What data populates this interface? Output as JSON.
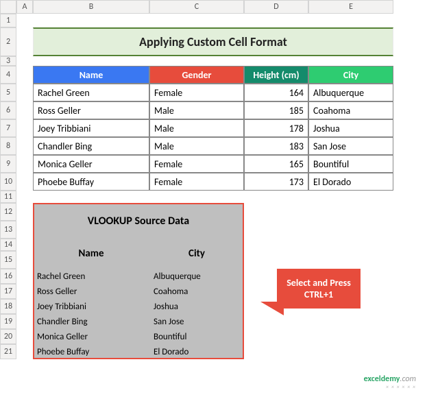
{
  "columns": [
    "A",
    "B",
    "C",
    "D",
    "E"
  ],
  "rows": [
    "1",
    "2",
    "3",
    "4",
    "5",
    "6",
    "7",
    "8",
    "9",
    "10",
    "11",
    "12",
    "13",
    "14",
    "15",
    "16",
    "17",
    "18",
    "19",
    "20",
    "21"
  ],
  "title": "Applying Custom Cell Format",
  "headers": {
    "name": "Name",
    "gender": "Gender",
    "height": "Height (cm)",
    "city": "City"
  },
  "people": [
    {
      "name": "Rachel Green",
      "gender": "Female",
      "height": "164",
      "city": "Albuquerque"
    },
    {
      "name": "Ross Geller",
      "gender": "Male",
      "height": "185",
      "city": "Coahoma"
    },
    {
      "name": "Joey Tribbiani",
      "gender": "Male",
      "height": "178",
      "city": "Joshua"
    },
    {
      "name": "Chandler Bing",
      "gender": "Male",
      "height": "183",
      "city": "San Jose"
    },
    {
      "name": "Monica Geller",
      "gender": "Female",
      "height": "165",
      "city": "Bountiful"
    },
    {
      "name": "Phoebe Buffay",
      "gender": "Female",
      "height": "173",
      "city": "El Dorado"
    }
  ],
  "source": {
    "title": "VLOOKUP Source Data",
    "name_hdr": "Name",
    "city_hdr": "City",
    "rows": [
      {
        "name": "Rachel Green",
        "city": "Albuquerque"
      },
      {
        "name": "Ross Geller",
        "city": "Coahoma"
      },
      {
        "name": "Joey Tribbiani",
        "city": "Joshua"
      },
      {
        "name": "Chandler Bing",
        "city": "San Jose"
      },
      {
        "name": "Monica Geller",
        "city": "Bountiful"
      },
      {
        "name": "Phoebe Buffay",
        "city": "El Dorado"
      }
    ]
  },
  "callout": "Select and Press CTRL+1",
  "watermark": {
    "brand": "exceldemy",
    "suffix": ".com"
  }
}
